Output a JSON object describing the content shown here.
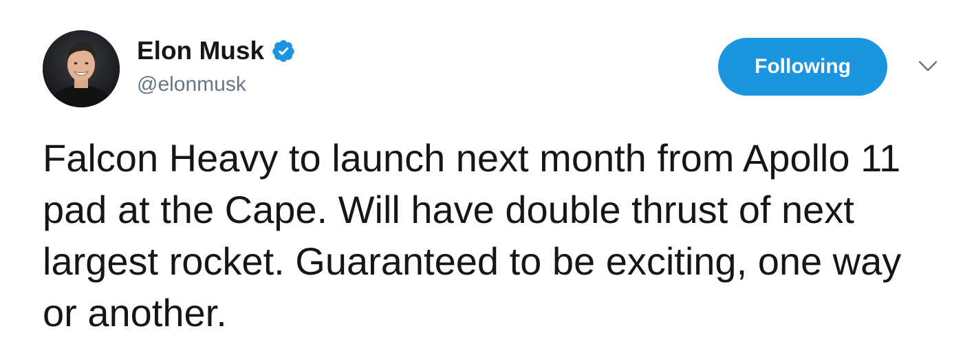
{
  "author": {
    "display_name": "Elon Musk",
    "handle": "@elonmusk",
    "verified_icon": "verified-badge-icon",
    "avatar": "profile-photo"
  },
  "actions": {
    "follow_label": "Following",
    "menu_icon": "chevron-down-icon"
  },
  "tweet": {
    "text": "Falcon Heavy to launch next month from Apollo 11 pad at the Cape. Will have double thrust of next largest rocket. Guaranteed to be exciting, one way or another."
  },
  "colors": {
    "accent": "#1b95e0",
    "text": "#14171a",
    "secondary_text": "#657786"
  }
}
